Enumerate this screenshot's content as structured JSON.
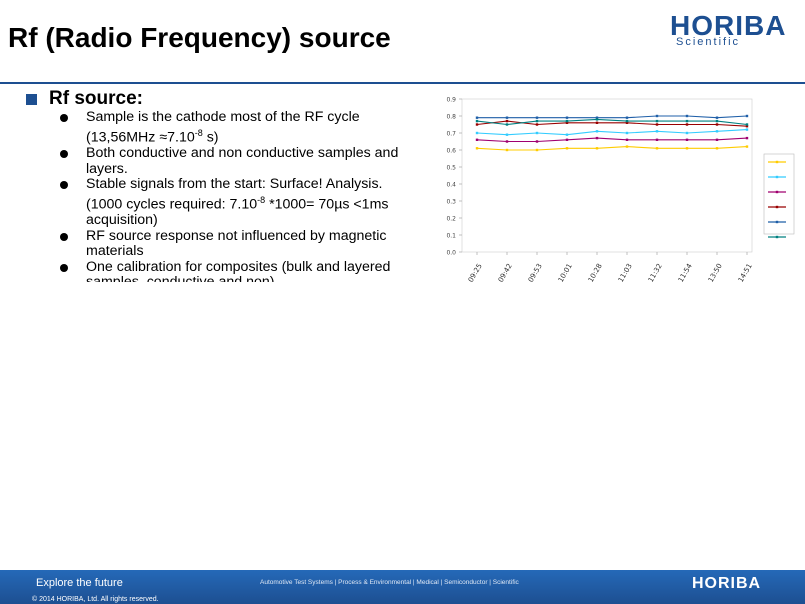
{
  "slide": {
    "title": "Rf  (Radio Frequency) source",
    "logo": {
      "main": "HORIBA",
      "sub": "Scientific"
    }
  },
  "section": {
    "heading": "Rf source:"
  },
  "bullets": [
    {
      "line1": "Sample is the cathode most of the RF cycle",
      "line2_pre": "(13,56MHz ≈7.10",
      "line2_sup": "-8",
      "line2_post": " s)"
    },
    {
      "text": "Both conductive and non conductive samples and layers."
    },
    {
      "line1": "Stable signals from the start: Surface! Analysis.",
      "line2_pre": "(1000 cycles required: 7.10",
      "line2_sup": "-8",
      "line2_post": " *1000= 70µs <1ms acquisition)"
    },
    {
      "text": "RF source response not influenced by magnetic materials"
    },
    {
      "text": "One calibration for composites (bulk and layered samples, conductive and non)"
    }
  ],
  "chart_data": {
    "type": "line",
    "categories": [
      "09:25",
      "09:42",
      "09:53",
      "10:01",
      "10:28",
      "11:03",
      "11:32",
      "11:54",
      "13:50",
      "14:51"
    ],
    "yticks": [
      "0.0",
      "0.1",
      "0.2",
      "0.3",
      "0.4",
      "0.5",
      "0.6",
      "0.7",
      "0.8",
      "0.9"
    ],
    "ylim": [
      0,
      0.9
    ],
    "series": [
      {
        "color": "#ffcc00",
        "values": [
          0.61,
          0.6,
          0.6,
          0.61,
          0.61,
          0.62,
          0.61,
          0.61,
          0.61,
          0.62
        ]
      },
      {
        "color": "#33ccff",
        "values": [
          0.7,
          0.69,
          0.7,
          0.69,
          0.71,
          0.7,
          0.71,
          0.7,
          0.71,
          0.72
        ]
      },
      {
        "color": "#a0006f",
        "values": [
          0.66,
          0.65,
          0.65,
          0.66,
          0.67,
          0.66,
          0.66,
          0.66,
          0.66,
          0.67
        ]
      },
      {
        "color": "#990000",
        "values": [
          0.75,
          0.77,
          0.75,
          0.76,
          0.76,
          0.76,
          0.75,
          0.75,
          0.75,
          0.74
        ]
      },
      {
        "color": "#1f5fa8",
        "values": [
          0.79,
          0.79,
          0.79,
          0.79,
          0.79,
          0.79,
          0.8,
          0.8,
          0.79,
          0.8
        ]
      },
      {
        "color": "#008080",
        "values": [
          0.77,
          0.75,
          0.77,
          0.77,
          0.78,
          0.77,
          0.77,
          0.77,
          0.77,
          0.75
        ]
      }
    ]
  },
  "footer": {
    "tagline": "Explore the future",
    "links": "Automotive Test Systems  |  Process & Environmental  |  Medical  |  Semiconductor  |  Scientific",
    "logo": "HORIBA",
    "copyright": "© 2014 HORIBA, Ltd. All rights reserved."
  }
}
